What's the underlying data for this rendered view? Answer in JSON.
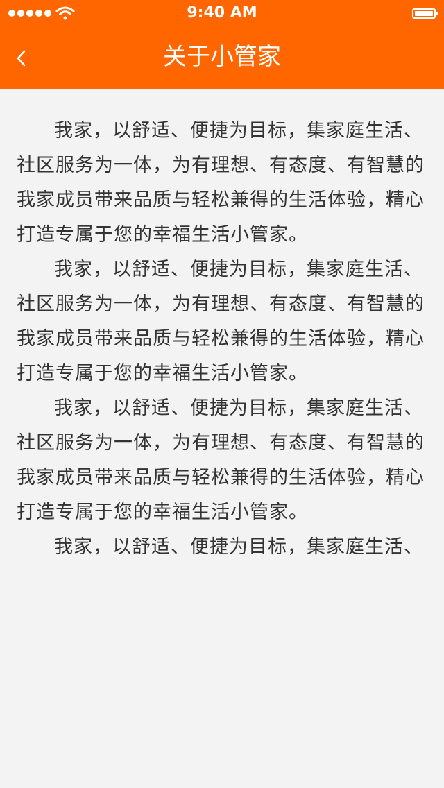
{
  "status_bar": {
    "time": "9:40 AM",
    "signal_icon": "signal-dots-icon",
    "wifi_icon": "wifi-icon",
    "battery_icon": "battery-icon",
    "battery_level": 1.0
  },
  "nav": {
    "title": "关于小管家",
    "back_icon": "chevron-left-icon"
  },
  "content": {
    "paragraphs": [
      "我家，以舒适、便捷为目标，集家庭生活、社区服务为一体，为有理想、有态度、有智慧的我家成员带来品质与轻松兼得的生活体验，精心打造专属于您的幸福生活小管家。",
      "我家，以舒适、便捷为目标，集家庭生活、社区服务为一体，为有理想、有态度、有智慧的我家成员带来品质与轻松兼得的生活体验，精心打造专属于您的幸福生活小管家。",
      "我家，以舒适、便捷为目标，集家庭生活、社区服务为一体，为有理想、有态度、有智慧的我家成员带来品质与轻松兼得的生活体验，精心打造专属于您的幸福生活小管家。",
      "我家，以舒适、便捷为目标，集家庭生活、"
    ]
  },
  "colors": {
    "accent": "#ff6600",
    "background": "#f3f3f3",
    "text": "#333333"
  }
}
